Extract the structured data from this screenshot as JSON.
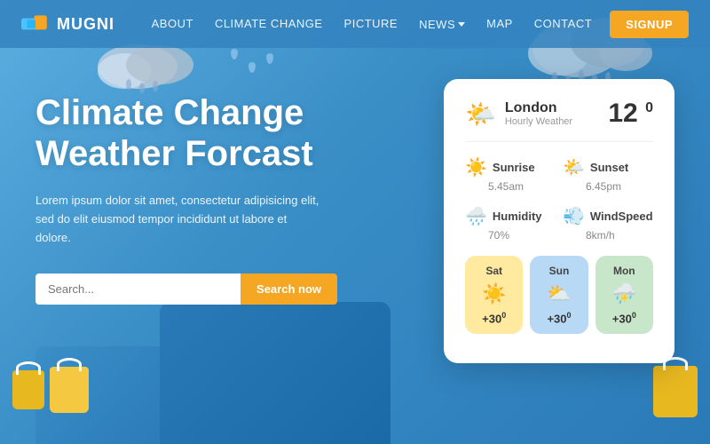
{
  "nav": {
    "logo": "MUGNI",
    "links": [
      {
        "id": "about",
        "label": "ABOUT"
      },
      {
        "id": "climate-change",
        "label": "CLIMATE CHANGE"
      },
      {
        "id": "picture",
        "label": "PICTURE"
      },
      {
        "id": "news",
        "label": "NEWS",
        "hasDropdown": true
      },
      {
        "id": "map",
        "label": "MAP"
      },
      {
        "id": "contact",
        "label": "CONTACT"
      }
    ],
    "signup_label": "SIGNUP"
  },
  "hero": {
    "headline_line1": "Climate Change",
    "headline_line2": "Weather Forcast",
    "subtext": "Lorem ipsum dolor sit amet, consectetur adipisicing elit, sed do elit eiusmod tempor incididunt ut labore et dolore.",
    "search_placeholder": "Search...",
    "search_button": "Search now"
  },
  "weather_card": {
    "city": "London",
    "subtitle": "Hourly Weather",
    "temperature": "12",
    "temp_unit": "0",
    "stats": [
      {
        "id": "sunrise",
        "icon": "☀️",
        "label": "Sunrise",
        "value": "5.45am"
      },
      {
        "id": "sunset",
        "icon": "🌤️",
        "label": "Sunset",
        "value": "6.45pm"
      },
      {
        "id": "humidity",
        "icon": "🌧️",
        "label": "Humidity",
        "value": "70%"
      },
      {
        "id": "windspeed",
        "icon": "💨",
        "label": "WindSpeed",
        "value": "8km/h"
      }
    ],
    "forecast": [
      {
        "id": "sat",
        "day": "Sat",
        "icon": "☀️",
        "temp": "+30",
        "unit": "0",
        "class": "sat"
      },
      {
        "id": "sun",
        "day": "Sun",
        "icon": "⛅",
        "temp": "+30",
        "unit": "0",
        "class": "sun"
      },
      {
        "id": "mon",
        "day": "Mon",
        "icon": "⛈️",
        "temp": "+30",
        "unit": "0",
        "class": "mon"
      }
    ]
  }
}
